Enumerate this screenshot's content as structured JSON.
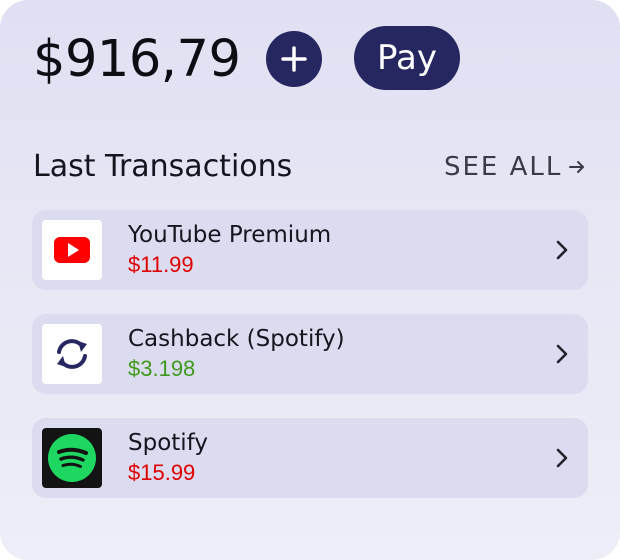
{
  "wallet": {
    "balance": "$916,79",
    "add_icon": "plus-icon",
    "pay_label": "Pay"
  },
  "transactions": {
    "title": "Last Transactions",
    "see_all_label": "SEE ALL",
    "see_all_icon": "arrow-right-icon",
    "items": [
      {
        "name": "YouTube Premium",
        "amount": "$11.99",
        "amount_color": "#e00000",
        "icon": "youtube-icon"
      },
      {
        "name": "Cashback (Spotify)",
        "amount": "$3.198",
        "amount_color": "#3f9a1c",
        "icon": "refresh-icon"
      },
      {
        "name": "Spotify",
        "amount": "$15.99",
        "amount_color": "#e00000",
        "icon": "spotify-icon"
      }
    ]
  },
  "colors": {
    "accent": "#262760",
    "negative": "#e00000",
    "positive": "#3f9a1c",
    "youtube_red": "#ff0000",
    "spotify_green": "#1ed760"
  }
}
